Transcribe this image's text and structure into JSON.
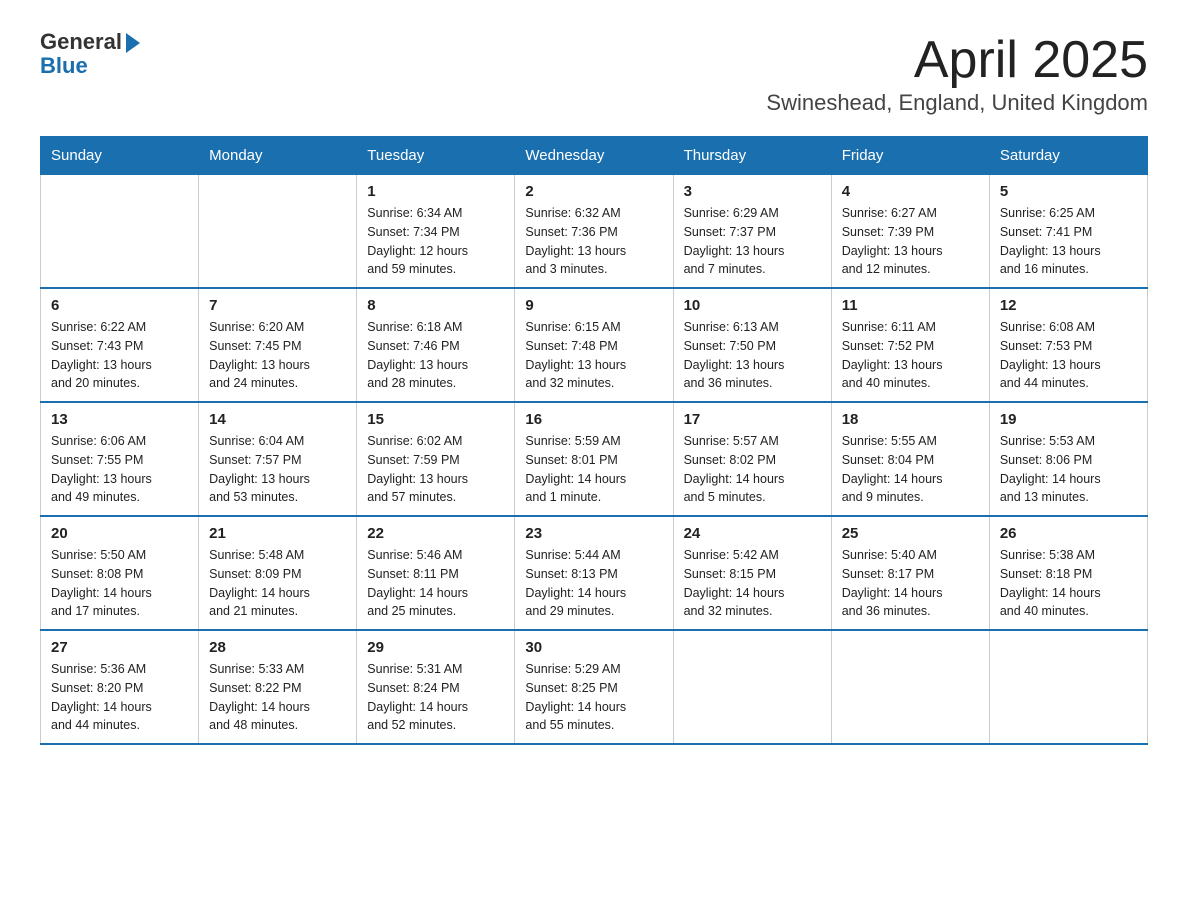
{
  "header": {
    "logo_general": "General",
    "logo_blue": "Blue",
    "title": "April 2025",
    "subtitle": "Swineshead, England, United Kingdom"
  },
  "days_of_week": [
    "Sunday",
    "Monday",
    "Tuesday",
    "Wednesday",
    "Thursday",
    "Friday",
    "Saturday"
  ],
  "weeks": [
    [
      {
        "day": "",
        "info": ""
      },
      {
        "day": "",
        "info": ""
      },
      {
        "day": "1",
        "info": "Sunrise: 6:34 AM\nSunset: 7:34 PM\nDaylight: 12 hours\nand 59 minutes."
      },
      {
        "day": "2",
        "info": "Sunrise: 6:32 AM\nSunset: 7:36 PM\nDaylight: 13 hours\nand 3 minutes."
      },
      {
        "day": "3",
        "info": "Sunrise: 6:29 AM\nSunset: 7:37 PM\nDaylight: 13 hours\nand 7 minutes."
      },
      {
        "day": "4",
        "info": "Sunrise: 6:27 AM\nSunset: 7:39 PM\nDaylight: 13 hours\nand 12 minutes."
      },
      {
        "day": "5",
        "info": "Sunrise: 6:25 AM\nSunset: 7:41 PM\nDaylight: 13 hours\nand 16 minutes."
      }
    ],
    [
      {
        "day": "6",
        "info": "Sunrise: 6:22 AM\nSunset: 7:43 PM\nDaylight: 13 hours\nand 20 minutes."
      },
      {
        "day": "7",
        "info": "Sunrise: 6:20 AM\nSunset: 7:45 PM\nDaylight: 13 hours\nand 24 minutes."
      },
      {
        "day": "8",
        "info": "Sunrise: 6:18 AM\nSunset: 7:46 PM\nDaylight: 13 hours\nand 28 minutes."
      },
      {
        "day": "9",
        "info": "Sunrise: 6:15 AM\nSunset: 7:48 PM\nDaylight: 13 hours\nand 32 minutes."
      },
      {
        "day": "10",
        "info": "Sunrise: 6:13 AM\nSunset: 7:50 PM\nDaylight: 13 hours\nand 36 minutes."
      },
      {
        "day": "11",
        "info": "Sunrise: 6:11 AM\nSunset: 7:52 PM\nDaylight: 13 hours\nand 40 minutes."
      },
      {
        "day": "12",
        "info": "Sunrise: 6:08 AM\nSunset: 7:53 PM\nDaylight: 13 hours\nand 44 minutes."
      }
    ],
    [
      {
        "day": "13",
        "info": "Sunrise: 6:06 AM\nSunset: 7:55 PM\nDaylight: 13 hours\nand 49 minutes."
      },
      {
        "day": "14",
        "info": "Sunrise: 6:04 AM\nSunset: 7:57 PM\nDaylight: 13 hours\nand 53 minutes."
      },
      {
        "day": "15",
        "info": "Sunrise: 6:02 AM\nSunset: 7:59 PM\nDaylight: 13 hours\nand 57 minutes."
      },
      {
        "day": "16",
        "info": "Sunrise: 5:59 AM\nSunset: 8:01 PM\nDaylight: 14 hours\nand 1 minute."
      },
      {
        "day": "17",
        "info": "Sunrise: 5:57 AM\nSunset: 8:02 PM\nDaylight: 14 hours\nand 5 minutes."
      },
      {
        "day": "18",
        "info": "Sunrise: 5:55 AM\nSunset: 8:04 PM\nDaylight: 14 hours\nand 9 minutes."
      },
      {
        "day": "19",
        "info": "Sunrise: 5:53 AM\nSunset: 8:06 PM\nDaylight: 14 hours\nand 13 minutes."
      }
    ],
    [
      {
        "day": "20",
        "info": "Sunrise: 5:50 AM\nSunset: 8:08 PM\nDaylight: 14 hours\nand 17 minutes."
      },
      {
        "day": "21",
        "info": "Sunrise: 5:48 AM\nSunset: 8:09 PM\nDaylight: 14 hours\nand 21 minutes."
      },
      {
        "day": "22",
        "info": "Sunrise: 5:46 AM\nSunset: 8:11 PM\nDaylight: 14 hours\nand 25 minutes."
      },
      {
        "day": "23",
        "info": "Sunrise: 5:44 AM\nSunset: 8:13 PM\nDaylight: 14 hours\nand 29 minutes."
      },
      {
        "day": "24",
        "info": "Sunrise: 5:42 AM\nSunset: 8:15 PM\nDaylight: 14 hours\nand 32 minutes."
      },
      {
        "day": "25",
        "info": "Sunrise: 5:40 AM\nSunset: 8:17 PM\nDaylight: 14 hours\nand 36 minutes."
      },
      {
        "day": "26",
        "info": "Sunrise: 5:38 AM\nSunset: 8:18 PM\nDaylight: 14 hours\nand 40 minutes."
      }
    ],
    [
      {
        "day": "27",
        "info": "Sunrise: 5:36 AM\nSunset: 8:20 PM\nDaylight: 14 hours\nand 44 minutes."
      },
      {
        "day": "28",
        "info": "Sunrise: 5:33 AM\nSunset: 8:22 PM\nDaylight: 14 hours\nand 48 minutes."
      },
      {
        "day": "29",
        "info": "Sunrise: 5:31 AM\nSunset: 8:24 PM\nDaylight: 14 hours\nand 52 minutes."
      },
      {
        "day": "30",
        "info": "Sunrise: 5:29 AM\nSunset: 8:25 PM\nDaylight: 14 hours\nand 55 minutes."
      },
      {
        "day": "",
        "info": ""
      },
      {
        "day": "",
        "info": ""
      },
      {
        "day": "",
        "info": ""
      }
    ]
  ]
}
